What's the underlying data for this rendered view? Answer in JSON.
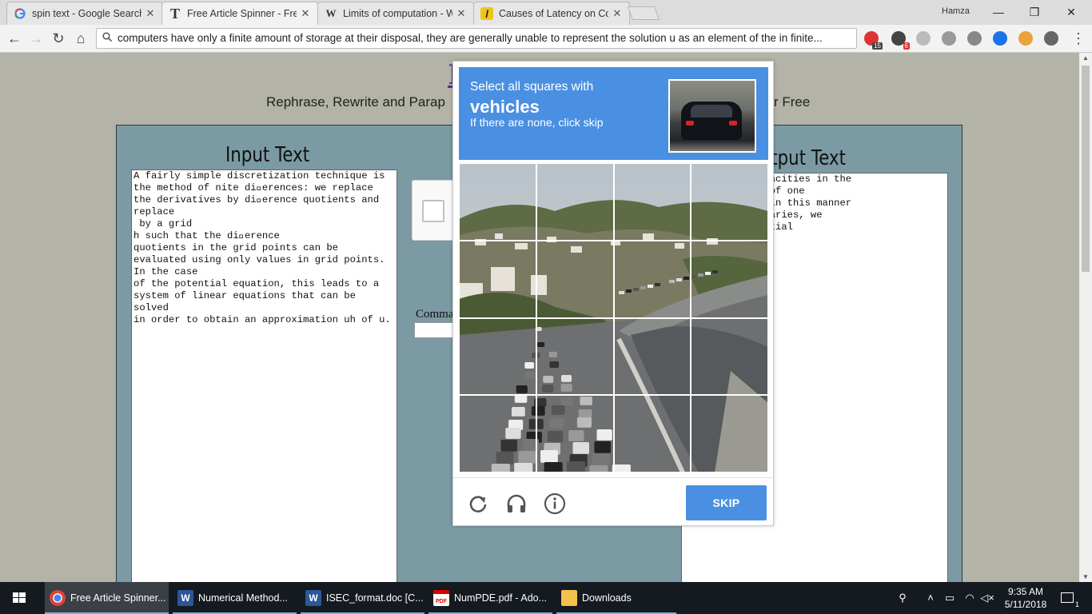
{
  "browser": {
    "tabs": [
      {
        "title": "spin text - Google Search",
        "icon": "google-icon"
      },
      {
        "title": "Free Article Spinner - Free",
        "icon": "t-site-icon"
      },
      {
        "title": "Limits of computation - W",
        "icon": "wikipedia-icon"
      },
      {
        "title": "Causes of Latency on Co",
        "icon": "site-icon"
      }
    ],
    "profile": "Hamza",
    "url": "computers have only a finite amount of storage at their disposal, they are generally unable to represent the solution u as an element of the in finite..."
  },
  "extensions": [
    {
      "name": "extension-red-icon",
      "badge": "15",
      "color": "#d33"
    },
    {
      "name": "extension-dark-icon",
      "badge": "6",
      "color": "#444"
    },
    {
      "name": "extension-grey-icon",
      "badge": "",
      "color": "#bbb"
    },
    {
      "name": "extension-cube-icon",
      "badge": "",
      "color": "#999"
    },
    {
      "name": "extension-puzzle-icon",
      "badge": "",
      "color": "#888"
    },
    {
      "name": "extension-wave-icon",
      "badge": "",
      "color": "#1a73e8"
    },
    {
      "name": "extension-pin-icon",
      "badge": "",
      "color": "#e8a33d"
    },
    {
      "name": "extension-dropper-icon",
      "badge": "",
      "color": "#666"
    }
  ],
  "page": {
    "site_title": "F",
    "tagline_left": "Rephrase, Rewrite and Parap",
    "tagline_right": "r Free",
    "input_heading": "Input Text",
    "output_heading": "Output Text",
    "input_text": "A fairly simple discretization technique is\nthe method of nite di\u0000erences: we replace\nthe derivatives by di\u0000erence quotients and\nreplace\n by a grid\nh such that the di\u0000erence\nquotients in the grid points can be\nevaluated using only values in grid points.\nIn the case\nof the potential equation, this leads to a\nsystem of linear equations that can be\nsolved\nin order to obtain an approximation uh of u.",
    "output_text": "ce that the capacities in the\nupon in excess of one\n the condition in this manner\nctional subsidiaries, we\nmplete differential",
    "command_label": "Comma"
  },
  "captcha": {
    "line1": "Select all squares with",
    "target": "vehicles",
    "line3": "If there are none, click skip",
    "skip_label": "SKIP",
    "grid_rows": 4,
    "grid_cols": 4,
    "accent": "#4a90e2"
  },
  "taskbar": {
    "items": [
      {
        "label": "Free Article Spinner...",
        "icon": "chrome-icon",
        "active": true
      },
      {
        "label": "Numerical Method...",
        "icon": "word-icon",
        "active": false
      },
      {
        "label": "ISEC_format.doc [C...",
        "icon": "word-icon",
        "active": false
      },
      {
        "label": "NumPDE.pdf - Ado...",
        "icon": "pdf-icon",
        "active": false
      },
      {
        "label": "Downloads",
        "icon": "folder-icon",
        "active": false
      }
    ],
    "time": "9:35 AM",
    "date": "5/11/2018",
    "notifications": "1"
  }
}
